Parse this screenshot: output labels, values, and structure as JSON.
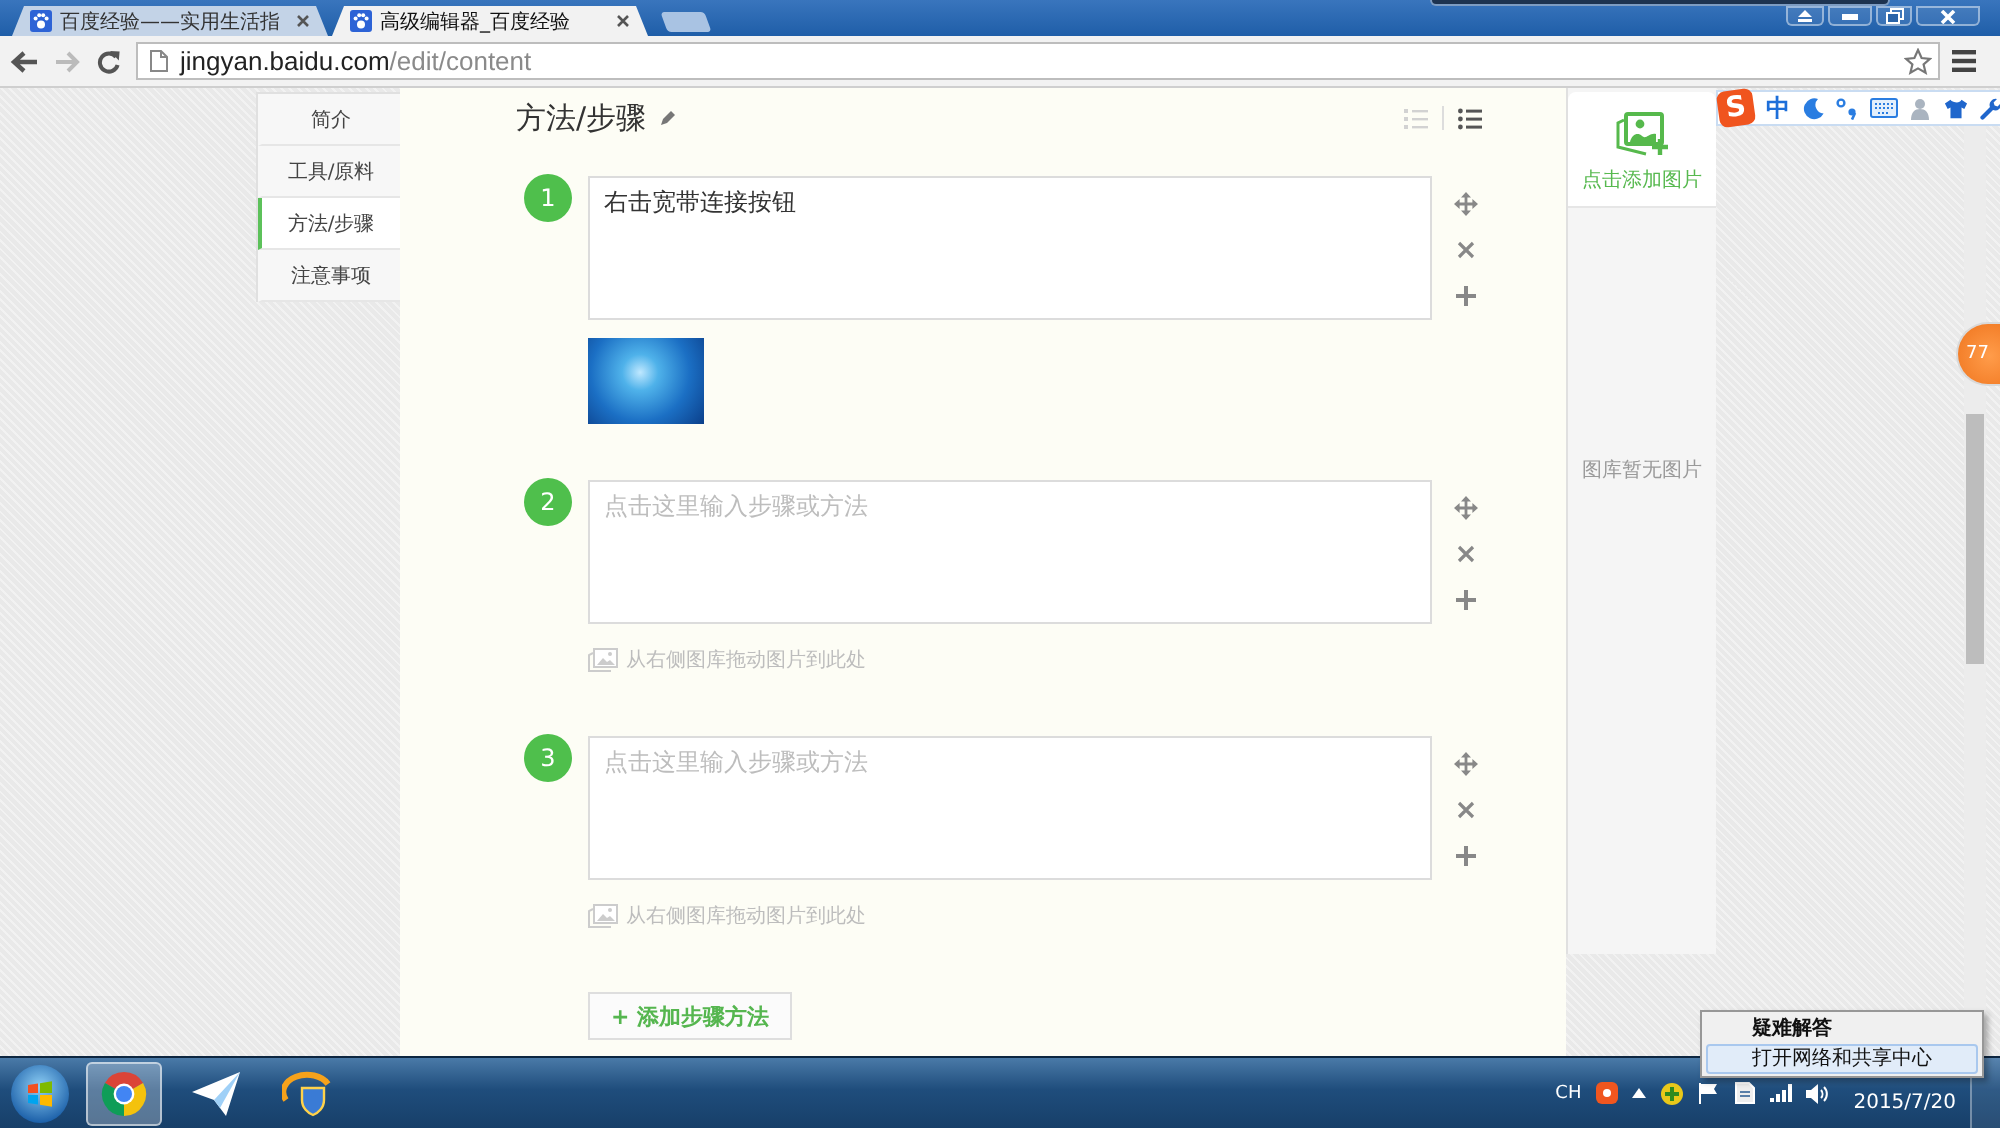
{
  "browser": {
    "tabs": [
      {
        "title": "百度经验——实用生活指",
        "selected": false
      },
      {
        "title": "高级编辑器_百度经验",
        "selected": true
      }
    ],
    "address": {
      "host": "jingyan.baidu.com",
      "path": "/edit/content"
    }
  },
  "sidebar": {
    "items": [
      {
        "label": "简介",
        "selected": false
      },
      {
        "label": "工具/原料",
        "selected": false
      },
      {
        "label": "方法/步骤",
        "selected": true
      },
      {
        "label": "注意事项",
        "selected": false
      }
    ]
  },
  "editor": {
    "title": "方法/步骤",
    "list_styles": [
      {
        "kind": "numbered",
        "selected": false
      },
      {
        "kind": "bulleted",
        "selected": true
      }
    ],
    "steps": [
      {
        "number": "1",
        "value": "右击宽带连接按钮",
        "image": true
      },
      {
        "number": "2",
        "placeholder": "点击这里输入步骤或方法",
        "image": false,
        "drop_hint": "从右侧图库拖动图片到此处"
      },
      {
        "number": "3",
        "placeholder": "点击这里输入步骤或方法",
        "image": false,
        "drop_hint": "从右侧图库拖动图片到此处"
      }
    ],
    "add_button": "+ 添加步骤方法"
  },
  "gallery": {
    "add_label": "点击添加图片",
    "empty_text": "图库暂无图片"
  },
  "ime_toolbar": {
    "logo": "S",
    "mode": "中"
  },
  "floating_badge": "77",
  "taskbar": {
    "apps": [
      {
        "kind": "browser",
        "active": true
      },
      {
        "kind": "messenger",
        "active": false
      },
      {
        "kind": "game",
        "active": false
      }
    ],
    "tray": {
      "language": "CH",
      "date": "2015/7/20"
    }
  },
  "tray_menu": {
    "items": [
      {
        "label": "疑难解答",
        "default": true,
        "selected": false
      },
      {
        "label": "打开网络和共享中心",
        "default": false,
        "selected": true
      }
    ]
  }
}
